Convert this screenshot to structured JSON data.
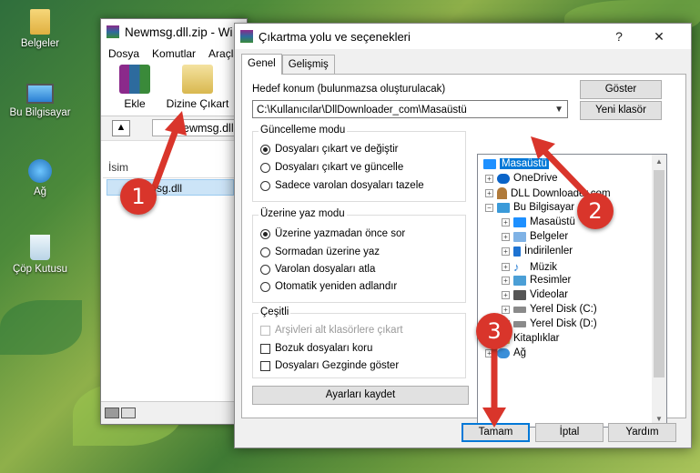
{
  "desktop": {
    "icons": [
      {
        "label": "Belgeler",
        "icon": "folder-user-icon"
      },
      {
        "label": "Bu Bilgisayar",
        "icon": "computer-icon"
      },
      {
        "label": "Ağ",
        "icon": "network-icon"
      },
      {
        "label": "Çöp Kutusu",
        "icon": "recycle-bin-icon"
      }
    ]
  },
  "winrar": {
    "title": "Newmsg.dll.zip - Wi",
    "menu": [
      "Dosya",
      "Komutlar",
      "Araçla"
    ],
    "toolbar": {
      "add_label": "Ekle",
      "extract_label": "Dizine Çıkart"
    },
    "address": "Newmsg.dll",
    "list_header": "İsim",
    "file": "Newmsg.dll"
  },
  "dialog": {
    "title": "Çıkartma yolu ve seçenekleri",
    "help_glyph": "?",
    "close_glyph": "✕",
    "tabs": [
      "Genel",
      "Gelişmiş"
    ],
    "dest_label": "Hedef konum (bulunmazsa oluşturulacak)",
    "dest_path": "C:\\Kullanıcılar\\DllDownloader_com\\Masaüstü",
    "show_button": "Göster",
    "new_folder_button": "Yeni klasör",
    "update_mode": {
      "title": "Güncelleme modu",
      "options": [
        "Dosyaları çıkart ve değiştir",
        "Dosyaları çıkart ve güncelle",
        "Sadece varolan dosyaları tazele"
      ],
      "selected": 0
    },
    "overwrite_mode": {
      "title": "Üzerine yaz modu",
      "options": [
        "Üzerine yazmadan önce sor",
        "Sormadan üzerine yaz",
        "Varolan dosyaları atla",
        "Otomatik yeniden adlandır"
      ],
      "selected": 0
    },
    "misc": {
      "title": "Çeşitli",
      "options": [
        {
          "label": "Arşivleri alt klasörlere çıkart",
          "checked": false,
          "disabled": true
        },
        {
          "label": "Bozuk dosyaları koru",
          "checked": false,
          "disabled": false
        },
        {
          "label": "Dosyaları Gezginde göster",
          "checked": false,
          "disabled": false
        }
      ]
    },
    "save_settings_button": "Ayarları kaydet",
    "tree": [
      {
        "label": "Masaüstü",
        "icon": "desktop-icon",
        "color": "#1e90ff",
        "selected": true
      },
      {
        "label": "OneDrive",
        "icon": "onedrive-icon",
        "color": "#0a64c8"
      },
      {
        "label": "DLL Downloader.com",
        "icon": "user-icon",
        "color": "#b07a3a"
      },
      {
        "label": "Bu Bilgisayar",
        "icon": "computer-icon",
        "color": "#3a9ad9"
      },
      {
        "label": "Masaüstü",
        "icon": "desktop-icon",
        "color": "#1e90ff"
      },
      {
        "label": "Belgeler",
        "icon": "documents-icon",
        "color": "#7fb2e5"
      },
      {
        "label": "İndirilenler",
        "icon": "downloads-icon",
        "color": "#1e73d2"
      },
      {
        "label": "Müzik",
        "icon": "music-icon",
        "color": "#2a7fd4"
      },
      {
        "label": "Resimler",
        "icon": "pictures-icon",
        "color": "#4b9fd6"
      },
      {
        "label": "Videolar",
        "icon": "videos-icon",
        "color": "#555555"
      },
      {
        "label": "Yerel Disk (C:)",
        "icon": "drive-icon",
        "color": "#8a8a8a"
      },
      {
        "label": "Yerel Disk (D:)",
        "icon": "drive-icon",
        "color": "#8a8a8a"
      },
      {
        "label": "Kitaplıklar",
        "icon": "libraries-icon",
        "color": "#e6b84a"
      },
      {
        "label": "Ağ",
        "icon": "network-icon",
        "color": "#3a8fd9"
      }
    ],
    "ok_button": "Tamam",
    "cancel_button": "İptal",
    "help_button": "Yardım"
  },
  "annotations": {
    "step1": "1",
    "step2": "2",
    "step3": "3",
    "color": "#d9352b"
  }
}
